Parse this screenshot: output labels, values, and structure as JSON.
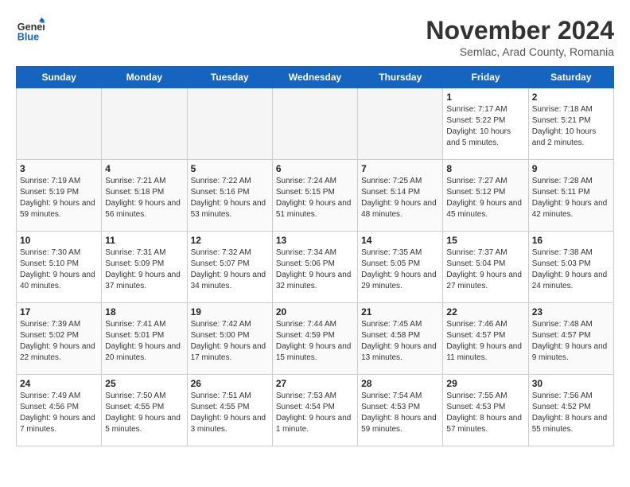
{
  "header": {
    "logo": {
      "line1": "General",
      "line2": "Blue"
    },
    "title": "November 2024",
    "location": "Semlac, Arad County, Romania"
  },
  "weekdays": [
    "Sunday",
    "Monday",
    "Tuesday",
    "Wednesday",
    "Thursday",
    "Friday",
    "Saturday"
  ],
  "weeks": [
    [
      {
        "day": "",
        "info": ""
      },
      {
        "day": "",
        "info": ""
      },
      {
        "day": "",
        "info": ""
      },
      {
        "day": "",
        "info": ""
      },
      {
        "day": "",
        "info": ""
      },
      {
        "day": "1",
        "info": "Sunrise: 7:17 AM\nSunset: 5:22 PM\nDaylight: 10 hours and 5 minutes."
      },
      {
        "day": "2",
        "info": "Sunrise: 7:18 AM\nSunset: 5:21 PM\nDaylight: 10 hours and 2 minutes."
      }
    ],
    [
      {
        "day": "3",
        "info": "Sunrise: 7:19 AM\nSunset: 5:19 PM\nDaylight: 9 hours and 59 minutes."
      },
      {
        "day": "4",
        "info": "Sunrise: 7:21 AM\nSunset: 5:18 PM\nDaylight: 9 hours and 56 minutes."
      },
      {
        "day": "5",
        "info": "Sunrise: 7:22 AM\nSunset: 5:16 PM\nDaylight: 9 hours and 53 minutes."
      },
      {
        "day": "6",
        "info": "Sunrise: 7:24 AM\nSunset: 5:15 PM\nDaylight: 9 hours and 51 minutes."
      },
      {
        "day": "7",
        "info": "Sunrise: 7:25 AM\nSunset: 5:14 PM\nDaylight: 9 hours and 48 minutes."
      },
      {
        "day": "8",
        "info": "Sunrise: 7:27 AM\nSunset: 5:12 PM\nDaylight: 9 hours and 45 minutes."
      },
      {
        "day": "9",
        "info": "Sunrise: 7:28 AM\nSunset: 5:11 PM\nDaylight: 9 hours and 42 minutes."
      }
    ],
    [
      {
        "day": "10",
        "info": "Sunrise: 7:30 AM\nSunset: 5:10 PM\nDaylight: 9 hours and 40 minutes."
      },
      {
        "day": "11",
        "info": "Sunrise: 7:31 AM\nSunset: 5:09 PM\nDaylight: 9 hours and 37 minutes."
      },
      {
        "day": "12",
        "info": "Sunrise: 7:32 AM\nSunset: 5:07 PM\nDaylight: 9 hours and 34 minutes."
      },
      {
        "day": "13",
        "info": "Sunrise: 7:34 AM\nSunset: 5:06 PM\nDaylight: 9 hours and 32 minutes."
      },
      {
        "day": "14",
        "info": "Sunrise: 7:35 AM\nSunset: 5:05 PM\nDaylight: 9 hours and 29 minutes."
      },
      {
        "day": "15",
        "info": "Sunrise: 7:37 AM\nSunset: 5:04 PM\nDaylight: 9 hours and 27 minutes."
      },
      {
        "day": "16",
        "info": "Sunrise: 7:38 AM\nSunset: 5:03 PM\nDaylight: 9 hours and 24 minutes."
      }
    ],
    [
      {
        "day": "17",
        "info": "Sunrise: 7:39 AM\nSunset: 5:02 PM\nDaylight: 9 hours and 22 minutes."
      },
      {
        "day": "18",
        "info": "Sunrise: 7:41 AM\nSunset: 5:01 PM\nDaylight: 9 hours and 20 minutes."
      },
      {
        "day": "19",
        "info": "Sunrise: 7:42 AM\nSunset: 5:00 PM\nDaylight: 9 hours and 17 minutes."
      },
      {
        "day": "20",
        "info": "Sunrise: 7:44 AM\nSunset: 4:59 PM\nDaylight: 9 hours and 15 minutes."
      },
      {
        "day": "21",
        "info": "Sunrise: 7:45 AM\nSunset: 4:58 PM\nDaylight: 9 hours and 13 minutes."
      },
      {
        "day": "22",
        "info": "Sunrise: 7:46 AM\nSunset: 4:57 PM\nDaylight: 9 hours and 11 minutes."
      },
      {
        "day": "23",
        "info": "Sunrise: 7:48 AM\nSunset: 4:57 PM\nDaylight: 9 hours and 9 minutes."
      }
    ],
    [
      {
        "day": "24",
        "info": "Sunrise: 7:49 AM\nSunset: 4:56 PM\nDaylight: 9 hours and 7 minutes."
      },
      {
        "day": "25",
        "info": "Sunrise: 7:50 AM\nSunset: 4:55 PM\nDaylight: 9 hours and 5 minutes."
      },
      {
        "day": "26",
        "info": "Sunrise: 7:51 AM\nSunset: 4:55 PM\nDaylight: 9 hours and 3 minutes."
      },
      {
        "day": "27",
        "info": "Sunrise: 7:53 AM\nSunset: 4:54 PM\nDaylight: 9 hours and 1 minute."
      },
      {
        "day": "28",
        "info": "Sunrise: 7:54 AM\nSunset: 4:53 PM\nDaylight: 8 hours and 59 minutes."
      },
      {
        "day": "29",
        "info": "Sunrise: 7:55 AM\nSunset: 4:53 PM\nDaylight: 8 hours and 57 minutes."
      },
      {
        "day": "30",
        "info": "Sunrise: 7:56 AM\nSunset: 4:52 PM\nDaylight: 8 hours and 55 minutes."
      }
    ]
  ]
}
